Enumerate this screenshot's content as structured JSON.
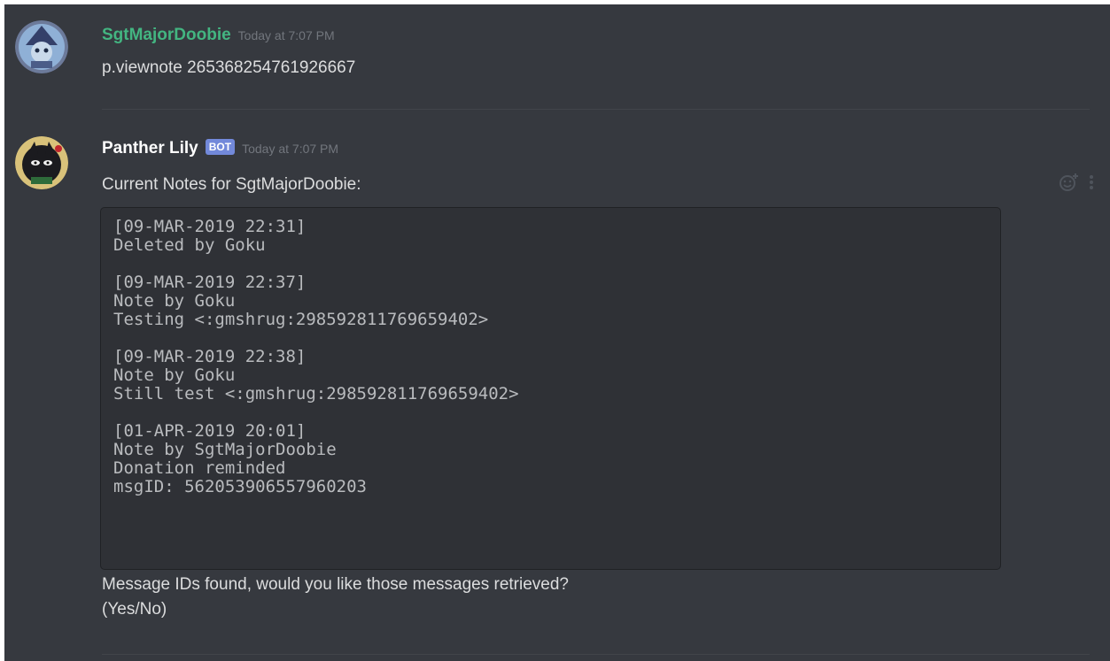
{
  "messages": [
    {
      "author": "SgtMajorDoobie",
      "timestamp": "Today at 7:07 PM",
      "content": "p.viewnote 265368254761926667"
    },
    {
      "author": "Panther Lily",
      "badge": "BOT",
      "timestamp": "Today at 7:07 PM",
      "intro": "Current Notes for SgtMajorDoobie:",
      "code": "[09-MAR-2019 22:31]\nDeleted by Goku\n\n[09-MAR-2019 22:37]\nNote by Goku\nTesting <:gmshrug:298592811769659402>\n\n[09-MAR-2019 22:38]\nNote by Goku\nStill test <:gmshrug:298592811769659402>\n\n[01-APR-2019 20:01]\nNote by SgtMajorDoobie\nDonation reminded\nmsgID: 562053906557960203",
      "footer_line1": "Message IDs found, would you like those messages retrieved?",
      "footer_line2": "(Yes/No)"
    }
  ],
  "icons": {
    "reaction": "add-reaction-icon",
    "more": "more-options-icon"
  },
  "colors": {
    "background": "#36393f",
    "username_green": "#43b581",
    "bot_badge": "#7289da",
    "code_background": "#2f3136",
    "timestamp": "#72767d"
  }
}
